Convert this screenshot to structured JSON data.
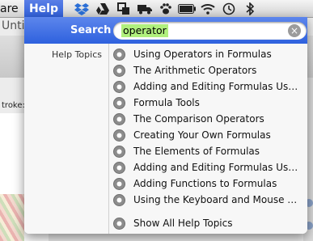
{
  "menubar": {
    "left_item": "are",
    "help_label": "Help",
    "status_icons": [
      "dropbox-icon",
      "google-drive-icon",
      "crashplan-icon",
      "truck-icon",
      "paw-icon",
      "battery-icon",
      "wifi-icon",
      "time-machine-icon",
      "bluetooth-icon"
    ]
  },
  "background_app": {
    "title_fragment": "Unti",
    "stroke_label": "troke:"
  },
  "help_menu": {
    "search_label": "Search",
    "search_value": "operator",
    "help_topics_heading": "Help Topics",
    "topics": [
      "Using Operators in Formulas",
      "The Arithmetic Operators",
      "Adding and Editing Formulas Usi...",
      "Formula Tools",
      "The Comparison Operators",
      "Creating Your Own Formulas",
      "The Elements of Formulas",
      "Adding and Editing Formulas Usi...",
      "Adding Functions to Formulas",
      "Using the Keyboard and Mouse t..."
    ],
    "show_all": "Show All Help Topics"
  },
  "colors": {
    "menu_highlight": "#2f5fd9",
    "search_highlight": "#b0f07d"
  }
}
